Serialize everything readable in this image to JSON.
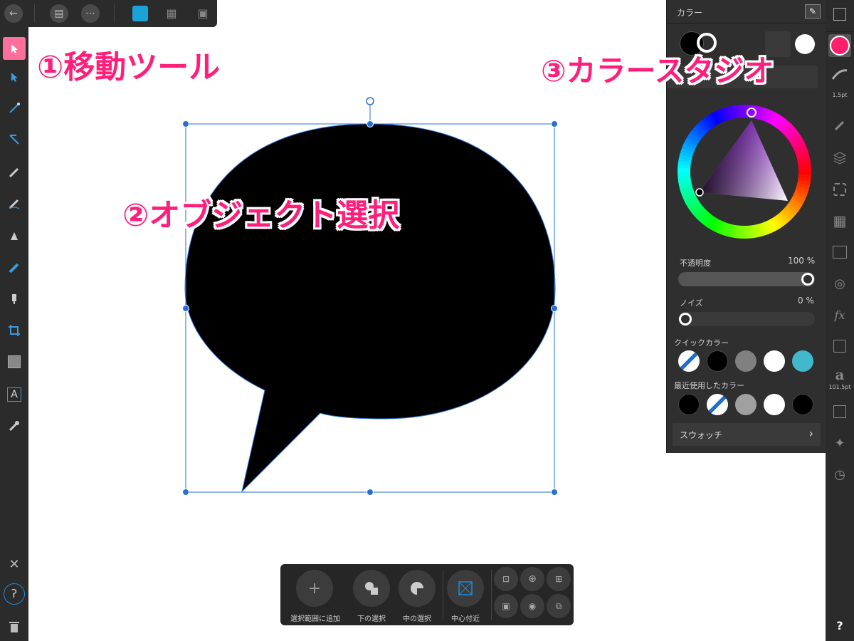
{
  "annotations": {
    "move_tool": "①移動ツール",
    "object_select": "②オブジェクト選択",
    "color_studio": "③カラースタジオ"
  },
  "color_panel": {
    "title": "カラー",
    "opacity_label": "不透明度",
    "opacity_value": "100 %",
    "opacity_fraction": 1.0,
    "noise_label": "ノイズ",
    "noise_value": "0 %",
    "noise_fraction": 0.0,
    "quick_colors_label": "クイックカラー",
    "quick_colors": [
      "none",
      "#000000",
      "#808080",
      "#ffffff",
      "#41b8cc"
    ],
    "recent_colors_label": "最近使用したカラー",
    "recent_colors": [
      "#000000",
      "none",
      "#a0a0a0",
      "#ffffff",
      "#000000"
    ],
    "swatches_label": "スウォッチ"
  },
  "right_studio": {
    "stroke_width": "1.5pt",
    "font_size": "101.5pt",
    "help": "?",
    "fill_color": "#ff1e6e"
  },
  "context_toolbar": {
    "add_selection": "選択範囲に追加",
    "select_below": "下の選択",
    "select_inside": "中の選択",
    "near_center": "中心付近"
  },
  "colors": {
    "accent": "#ff1e7a",
    "panel_bg": "#2f2f2f",
    "selection": "#2a6fd6"
  }
}
